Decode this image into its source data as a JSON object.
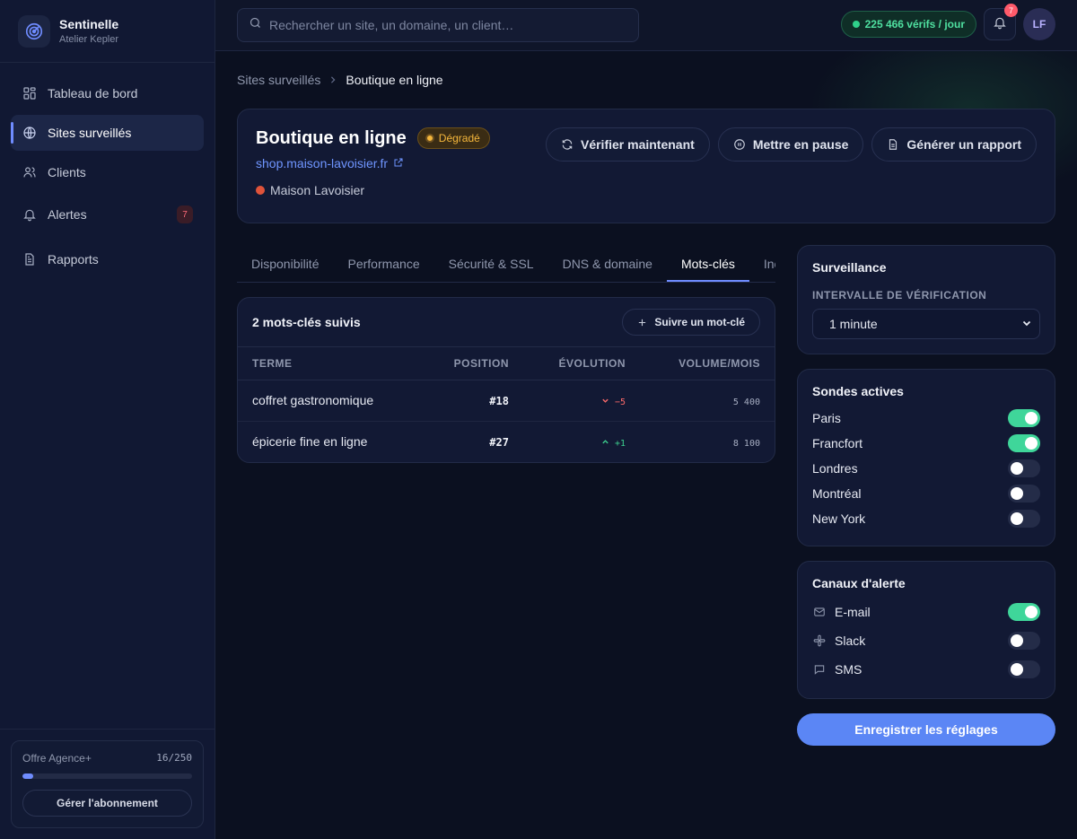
{
  "brand": {
    "name": "Sentinelle",
    "workspace": "Atelier Kepler"
  },
  "sidebar": {
    "items": [
      {
        "label": "Tableau de bord",
        "icon": "dashboard-icon"
      },
      {
        "label": "Sites surveillés",
        "icon": "globe-icon",
        "active": true
      },
      {
        "label": "Clients",
        "icon": "users-icon"
      },
      {
        "label": "Alertes",
        "icon": "bell-icon",
        "badge": "7"
      },
      {
        "label": "Rapports",
        "icon": "document-icon"
      }
    ],
    "plan": {
      "name": "Offre Agence+",
      "count": "16/250",
      "usage_fraction": 0.064,
      "manage_label": "Gérer l'abonnement"
    }
  },
  "topbar": {
    "search_placeholder": "Rechercher un site, un domaine, un client…",
    "checks_label": "225 466 vérifs / jour",
    "notifications_count": "7",
    "avatar_initials": "LF"
  },
  "breadcrumb": {
    "parent": "Sites surveillés",
    "current": "Boutique en ligne"
  },
  "site": {
    "title": "Boutique en ligne",
    "status": "Dégradé",
    "url": "shop.maison-lavoisier.fr",
    "client": "Maison Lavoisier",
    "actions": {
      "verify": "Vérifier maintenant",
      "pause": "Mettre en pause",
      "report": "Générer un rapport"
    }
  },
  "tabs": [
    {
      "label": "Disponibilité"
    },
    {
      "label": "Performance"
    },
    {
      "label": "Sécurité & SSL"
    },
    {
      "label": "DNS & domaine"
    },
    {
      "label": "Mots-clés",
      "active": true
    },
    {
      "label": "Incidents"
    }
  ],
  "keywords": {
    "title": "2 mots-clés suivis",
    "follow_label": "Suivre un mot-clé",
    "columns": {
      "term": "TERME",
      "position": "POSITION",
      "evolution": "ÉVOLUTION",
      "volume": "VOLUME/MOIS"
    },
    "rows": [
      {
        "term": "coffret gastronomique",
        "position": "#18",
        "evolution": "−5",
        "direction": "down",
        "volume": "5 400"
      },
      {
        "term": "épicerie fine en ligne",
        "position": "#27",
        "evolution": "+1",
        "direction": "up",
        "volume": "8 100"
      }
    ]
  },
  "monitoring": {
    "title": "Surveillance",
    "interval_label": "INTERVALLE DE VÉRIFICATION",
    "interval_value": "1 minute"
  },
  "probes": {
    "title": "Sondes actives",
    "items": [
      {
        "label": "Paris",
        "on": true
      },
      {
        "label": "Francfort",
        "on": true
      },
      {
        "label": "Londres",
        "on": false
      },
      {
        "label": "Montréal",
        "on": false
      },
      {
        "label": "New York",
        "on": false
      }
    ]
  },
  "channels": {
    "title": "Canaux d'alerte",
    "items": [
      {
        "label": "E-mail",
        "icon": "mail-icon",
        "on": true
      },
      {
        "label": "Slack",
        "icon": "slack-icon",
        "on": false
      },
      {
        "label": "SMS",
        "icon": "chat-icon",
        "on": false
      }
    ]
  },
  "save_label": "Enregistrer les réglages",
  "colors": {
    "accent": "#6f8cff",
    "success": "#3fd69a",
    "warning": "#f5b73c",
    "danger": "#ff6b6b"
  }
}
